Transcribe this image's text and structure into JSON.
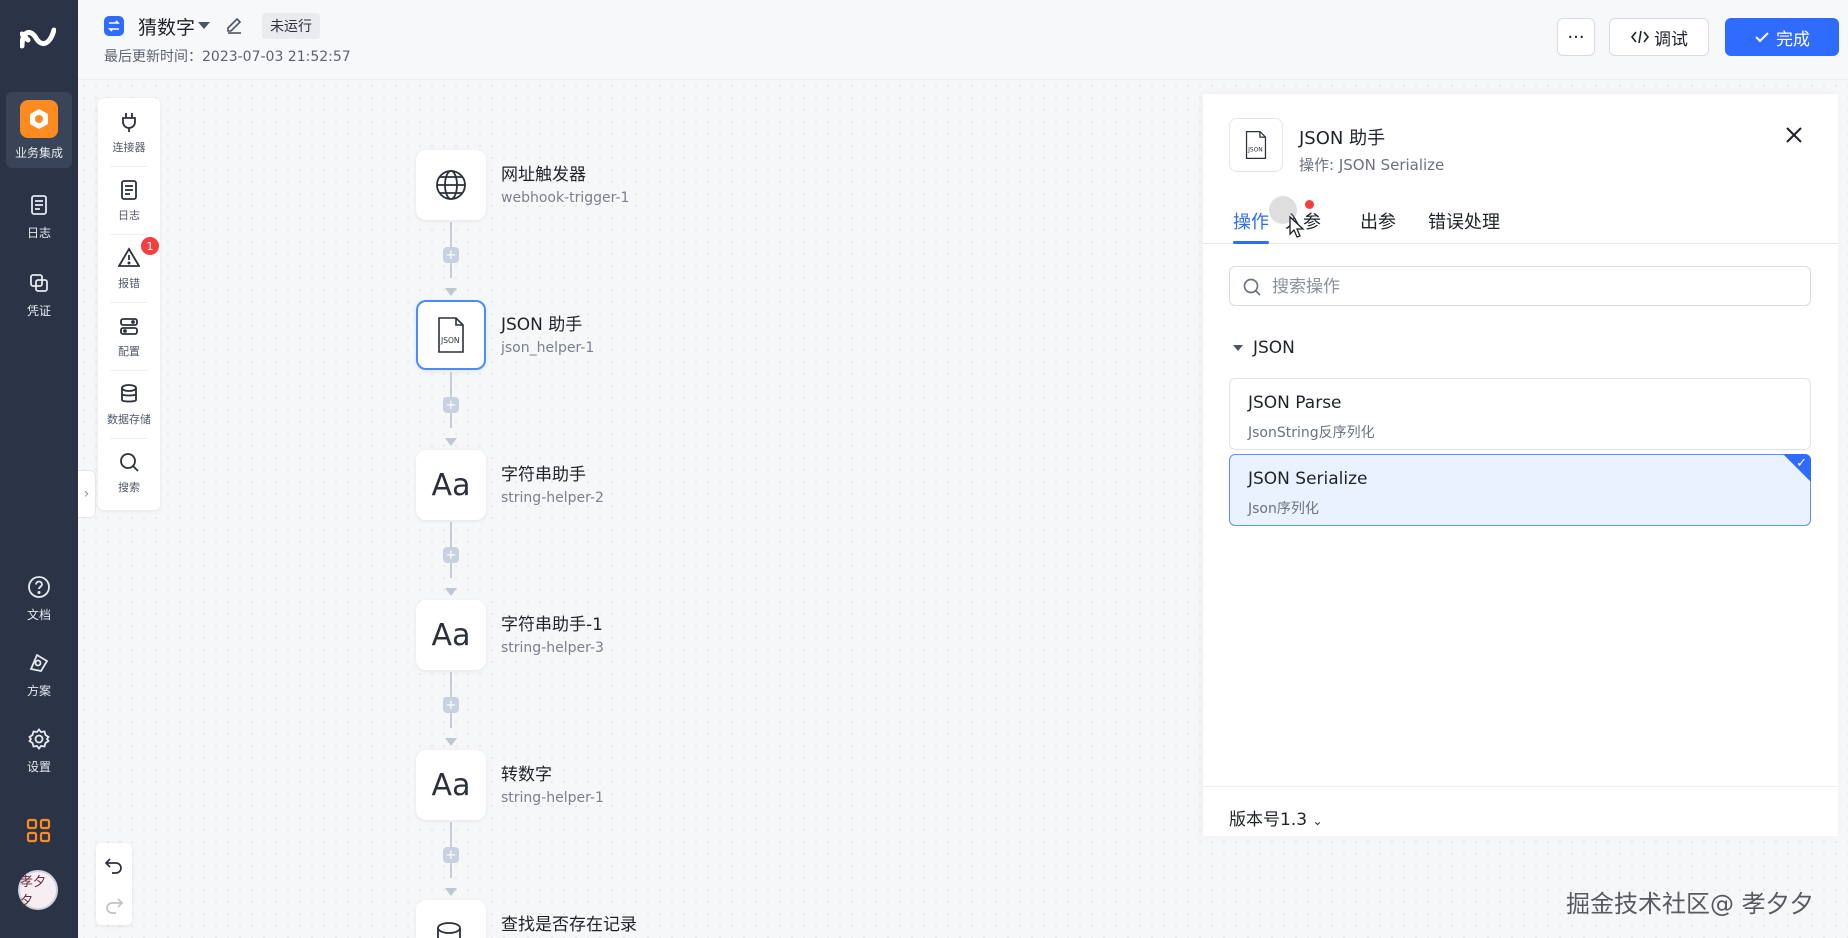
{
  "rail": {
    "items": [
      {
        "label": "业务集成",
        "icon": "integration-icon"
      },
      {
        "label": "日志",
        "icon": "log-icon"
      },
      {
        "label": "凭证",
        "icon": "credential-icon"
      },
      {
        "label": "文档",
        "icon": "help-icon"
      },
      {
        "label": "方案",
        "icon": "solution-icon"
      },
      {
        "label": "设置",
        "icon": "settings-icon"
      }
    ],
    "avatar_text": "孝夕夕"
  },
  "header": {
    "flow_name": "猜数字",
    "status": "未运行",
    "updated": "最后更新时间：2023-07-03 21:52:57",
    "more_label": "···",
    "debug_label": "调试",
    "done_label": "完成"
  },
  "tools": [
    {
      "label": "连接器",
      "icon": "plug-icon"
    },
    {
      "label": "日志",
      "icon": "log-icon"
    },
    {
      "label": "报错",
      "icon": "warning-icon"
    },
    {
      "label": "配置",
      "icon": "config-icon"
    },
    {
      "label": "数据存储",
      "icon": "database-icon"
    },
    {
      "label": "搜索",
      "icon": "search-icon"
    }
  ],
  "error_count": "1",
  "nodes": [
    {
      "name": "网址触发器",
      "id": "webhook-trigger-1",
      "icon": "globe-icon"
    },
    {
      "name": "JSON 助手",
      "id": "json_helper-1",
      "icon": "json-file-icon"
    },
    {
      "name": "字符串助手",
      "id": "string-helper-2",
      "icon": "text-icon"
    },
    {
      "name": "字符串助手-1",
      "id": "string-helper-3",
      "icon": "text-icon"
    },
    {
      "name": "转数字",
      "id": "string-helper-1",
      "icon": "text-icon"
    },
    {
      "name": "查找是否存在记录",
      "id": "",
      "icon": "database-icon"
    }
  ],
  "node_glyph": "Aa",
  "plus": "+",
  "panel": {
    "title": "JSON 助手",
    "subtitle": "操作: JSON Serialize",
    "tabs": [
      "操作",
      "入参",
      "出参",
      "错误处理"
    ],
    "active_tab": 0,
    "search_placeholder": "搜索操作",
    "group": "JSON",
    "operations": [
      {
        "name": "JSON Parse",
        "desc": "JsonString反序列化",
        "selected": false
      },
      {
        "name": "JSON Serialize",
        "desc": "Json序列化",
        "selected": true
      }
    ],
    "version": "版本号1.3"
  },
  "watermark": "掘金技术社区@ 孝夕夕",
  "colors": {
    "accent": "#2f6bff",
    "rail": "#2b3446",
    "orange": "#ff8a1f",
    "error": "#f53f3f"
  }
}
